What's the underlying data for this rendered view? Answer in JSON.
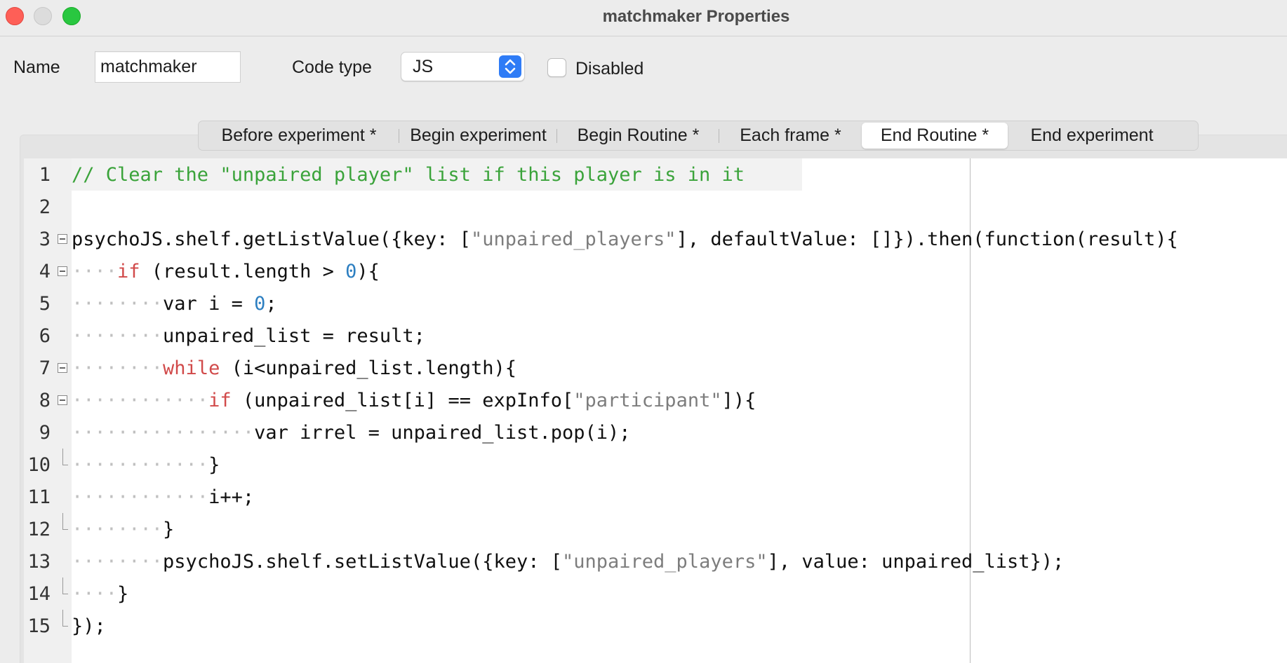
{
  "window": {
    "title": "matchmaker Properties"
  },
  "form": {
    "name_label": "Name",
    "name_value": "matchmaker",
    "code_type_label": "Code type",
    "code_type_value": "JS",
    "disabled_label": "Disabled",
    "disabled_checked": false
  },
  "tabs": [
    {
      "label": "Before experiment *",
      "active": false
    },
    {
      "label": "Begin experiment",
      "active": false
    },
    {
      "label": "Begin Routine *",
      "active": false
    },
    {
      "label": "Each frame *",
      "active": false
    },
    {
      "label": "End Routine *",
      "active": true
    },
    {
      "label": "End experiment",
      "active": false
    }
  ],
  "editor": {
    "lines": [
      {
        "num": "1"
      },
      {
        "num": "2"
      },
      {
        "num": "3"
      },
      {
        "num": "4"
      },
      {
        "num": "5"
      },
      {
        "num": "6"
      },
      {
        "num": "7"
      },
      {
        "num": "8"
      },
      {
        "num": "9"
      },
      {
        "num": "10"
      },
      {
        "num": "11"
      },
      {
        "num": "12"
      },
      {
        "num": "13"
      },
      {
        "num": "14"
      },
      {
        "num": "15"
      }
    ],
    "code": {
      "l1": "// Clear the \"unpaired player\" list if this player is in it",
      "l3a": "psychoJS.shelf.getListValue({key: [",
      "l3b": "\"unpaired_players\"",
      "l3c": "], defaultValue: []}).then(function(result){",
      "l4a": "if",
      "l4b": " (result.length > ",
      "l4c": "0",
      "l4d": "){",
      "l5a": "var i = ",
      "l5b": "0",
      "l5c": ";",
      "l6": "unpaired_list = result;",
      "l7a": "while",
      "l7b": " (i<unpaired_list.length){",
      "l8a": "if",
      "l8b": " (unpaired_list[i] == expInfo[",
      "l8c": "\"participant\"",
      "l8d": "]){",
      "l9": "var irrel = unpaired_list.pop(i);",
      "l10": "}",
      "l11": "i++;",
      "l12": "}",
      "l13a": "psychoJS.shelf.setListValue({key: [",
      "l13b": "\"unpaired_players\"",
      "l13c": "], value: unpaired_list});",
      "l14": "}",
      "l15": "});"
    }
  },
  "colors": {
    "comment": "#3aa33a",
    "keyword": "#d14a4a",
    "number": "#2d7fc1",
    "string": "#7d7d7d",
    "accent": "#2f7cf6"
  }
}
